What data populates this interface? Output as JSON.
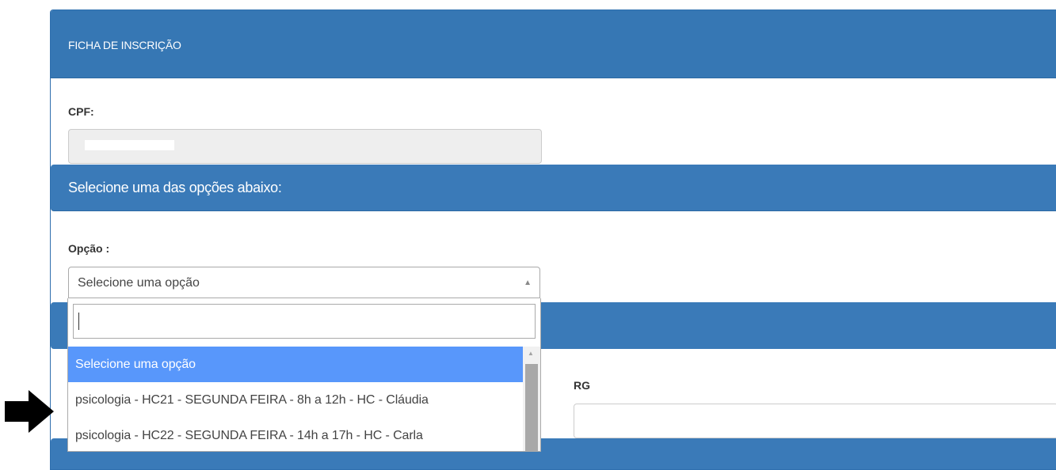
{
  "panel": {
    "title": "FICHA DE INSCRIÇÃO"
  },
  "cpf": {
    "label": "CPF:",
    "value": ""
  },
  "section": {
    "title": "Selecione uma das opções abaixo:"
  },
  "opcao": {
    "label": "Opção :",
    "selected": "Selecione uma opção",
    "search_value": "",
    "options": [
      "Selecione uma opção",
      "psicologia - HC21 - SEGUNDA FEIRA - 8h a 12h - HC - Cláudia",
      "psicologia - HC22 - SEGUNDA FEIRA - 14h a 17h - HC - Carla"
    ]
  },
  "rg": {
    "label": "RG",
    "value": ""
  },
  "colors": {
    "header_blue": "#3677b4",
    "highlight_blue": "#5897fb",
    "disabled_gray": "#eeeeee"
  },
  "icons": [
    "arrow-up-icon",
    "scroll-up-icon",
    "right-arrow-pointer-icon"
  ]
}
